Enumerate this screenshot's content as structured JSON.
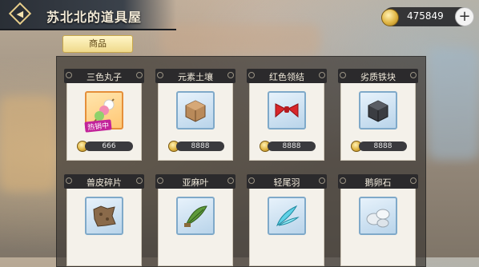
{
  "header": {
    "title": "苏北北的道具屋"
  },
  "currency": {
    "amount": "475849",
    "add_label": "+"
  },
  "tabs": [
    {
      "label": "商品",
      "active": true
    }
  ],
  "items": [
    {
      "name": "三色丸子",
      "price": "666",
      "icon": "dango-icon",
      "tag": "热销中",
      "highlight": "gold"
    },
    {
      "name": "元素土壤",
      "price": "8888",
      "icon": "soil-icon"
    },
    {
      "name": "红色领结",
      "price": "8888",
      "icon": "red-bowtie-icon"
    },
    {
      "name": "劣质铁块",
      "price": "8888",
      "icon": "iron-block-icon"
    },
    {
      "name": "兽皮碎片",
      "price": "",
      "icon": "hide-fragment-icon"
    },
    {
      "name": "亚麻叶",
      "price": "",
      "icon": "flax-leaf-icon"
    },
    {
      "name": "轻尾羽",
      "price": "",
      "icon": "tail-feather-icon"
    },
    {
      "name": "鹅卵石",
      "price": "",
      "icon": "pebble-icon"
    }
  ],
  "colors": {
    "accent": "#efd98b",
    "card_header": "#2b2a2c",
    "hot_tag": "#c2239a"
  }
}
